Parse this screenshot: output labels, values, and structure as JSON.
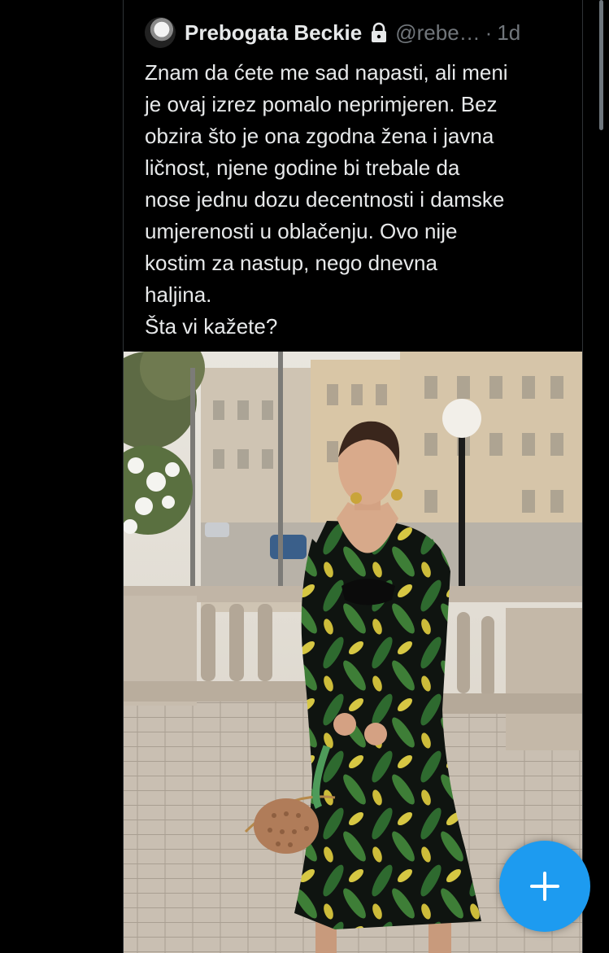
{
  "tweet": {
    "display_name": "Prebogata Beckie",
    "lock_icon": "lock-icon",
    "handle": "@rebe…",
    "separator": "·",
    "time": "1d",
    "text": "Znam da ćete me sad napasti, ali meni\nje ovaj izrez pomalo neprimjeren. Bez\nobzira što je ona zgodna žena i javna\nličnost, njene godine bi trebale da\nnose jednu dozu decentnosti i damske\numjerenosti u oblačenju. Ovo nije\nkostim za nastup, nego dnevna\nhaljina.\nŠta vi kažete?"
  },
  "fab": {
    "icon": "plus-icon",
    "color": "#1d9bf0"
  },
  "colors": {
    "background": "#000000",
    "primary_text": "#e7e9ea",
    "secondary_text": "#71767b",
    "accent": "#1d9bf0"
  }
}
